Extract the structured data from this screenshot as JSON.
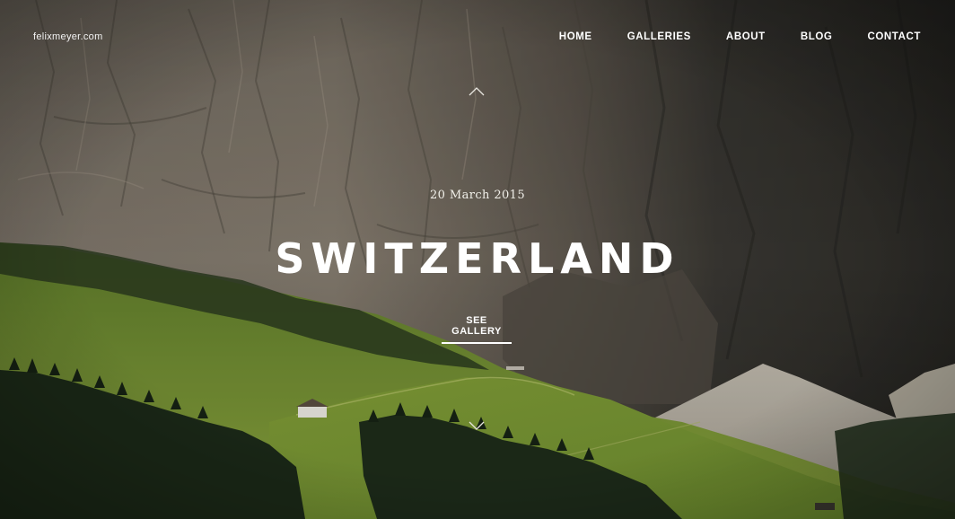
{
  "header": {
    "brand": "felixmeyer.com",
    "nav": [
      "HOME",
      "GALLERIES",
      "ABOUT",
      "BLOG",
      "CONTACT"
    ]
  },
  "hero": {
    "date": "20 March 2015",
    "title": "SWITZERLAND",
    "cta_label": "SEE GALLERY",
    "scroll_up_icon": "chevron-up-icon",
    "scroll_down_icon": "chevron-down-icon"
  },
  "colors": {
    "text": "#ffffff",
    "rock": "#6f675c",
    "meadow": "#6f8a30",
    "forest": "#1f2b1c"
  }
}
